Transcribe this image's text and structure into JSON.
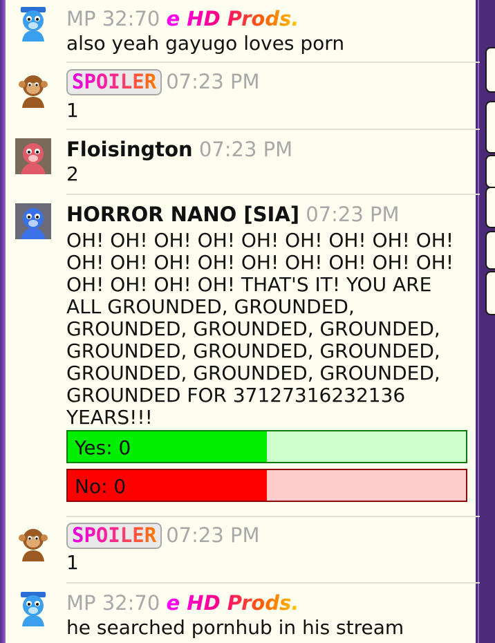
{
  "messages": [
    {
      "author_prefix": "MP 32:70 ",
      "author": "e HD Prods.",
      "avatar": "blue-bear-avatar",
      "text": "also yeah gayugo loves porn"
    },
    {
      "badge": "SPOILER",
      "time": "07:23 PM",
      "avatar": "brown-monkey-avatar",
      "text": "1"
    },
    {
      "author": "Floisington",
      "time": "07:23 PM",
      "avatar": "red-bear-avatar",
      "text": "2"
    },
    {
      "author": "HORROR NANO [SIA]",
      "time": "07:23 PM",
      "avatar": "blue-bear-avatar",
      "text": "OH! OH! OH! OH! OH! OH! OH! OH! OH! OH! OH! OH! OH! OH! OH! OH! OH! OH! OH! OH! OH! OH! THAT'S IT! YOU ARE ALL GROUNDED, GROUNDED, GROUNDED, GROUNDED, GROUNDED, GROUNDED, GROUNDED, GROUNDED, GROUNDED, GROUNDED, GROUNDED, GROUNDED FOR 37127316232136 YEARS!!!",
      "poll": {
        "yes_label": "Yes: 0",
        "no_label": "No: 0",
        "yes_fraction": 0.5,
        "no_fraction": 0.5
      }
    },
    {
      "badge": "SPOILER",
      "time": "07:23 PM",
      "avatar": "brown-monkey-avatar",
      "text": "1"
    },
    {
      "author_prefix": "MP 32:70 ",
      "author": "e HD Prods.",
      "avatar": "blue-bear-avatar",
      "text": "he searched pornhub in his stream"
    }
  ],
  "colors": {
    "background": "#fdfdf0",
    "frame": "#4c2a78",
    "timestamp": "#a8a8a8",
    "poll_yes": "#00ee00",
    "poll_no": "#ff0000"
  }
}
